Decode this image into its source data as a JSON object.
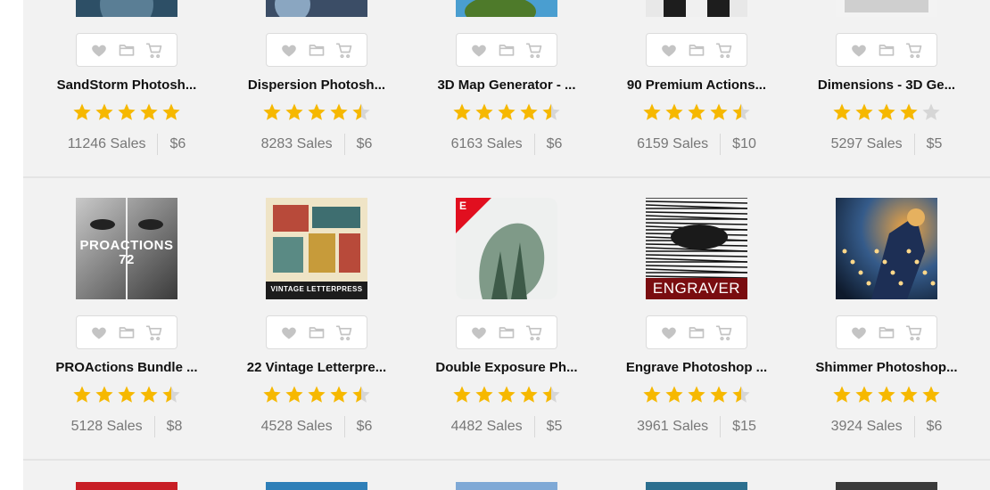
{
  "colors": {
    "star_on": "#f6b800",
    "star_off": "#d6d6d6",
    "icon": "#c4c4c4"
  },
  "icons": [
    "heart-icon",
    "folder-icon",
    "cart-icon"
  ],
  "rows": [
    {
      "items": [
        {
          "title": "SandStorm Photosh...",
          "rating": 5,
          "sales": "11246 Sales",
          "price": "$6"
        },
        {
          "title": "Dispersion Photosh...",
          "rating": 4.5,
          "sales": "8283 Sales",
          "price": "$6"
        },
        {
          "title": "3D Map Generator - ...",
          "rating": 4.5,
          "sales": "6163 Sales",
          "price": "$6"
        },
        {
          "title": "90 Premium Actions...",
          "rating": 4.5,
          "sales": "6159 Sales",
          "price": "$10"
        },
        {
          "title": "Dimensions - 3D Ge...",
          "rating": 4,
          "sales": "5297 Sales",
          "price": "$5"
        }
      ]
    },
    {
      "items": [
        {
          "title": "PROActions Bundle ...",
          "rating": 4.5,
          "sales": "5128 Sales",
          "price": "$8",
          "thumb_text": [
            "PROACTIONS",
            "72"
          ]
        },
        {
          "title": "22 Vintage Letterpre...",
          "rating": 4.5,
          "sales": "4528 Sales",
          "price": "$6",
          "thumb_text": [
            "VINTAGE LETTERPRESS"
          ]
        },
        {
          "title": "Double Exposure Ph...",
          "rating": 4.5,
          "sales": "4482 Sales",
          "price": "$5",
          "thumb_text": [
            "E"
          ]
        },
        {
          "title": "Engrave Photoshop ...",
          "rating": 4.5,
          "sales": "3961 Sales",
          "price": "$15",
          "thumb_text": [
            "ENGRAVER"
          ]
        },
        {
          "title": "Shimmer Photoshop...",
          "rating": 5,
          "sales": "3924 Sales",
          "price": "$6"
        }
      ]
    }
  ]
}
